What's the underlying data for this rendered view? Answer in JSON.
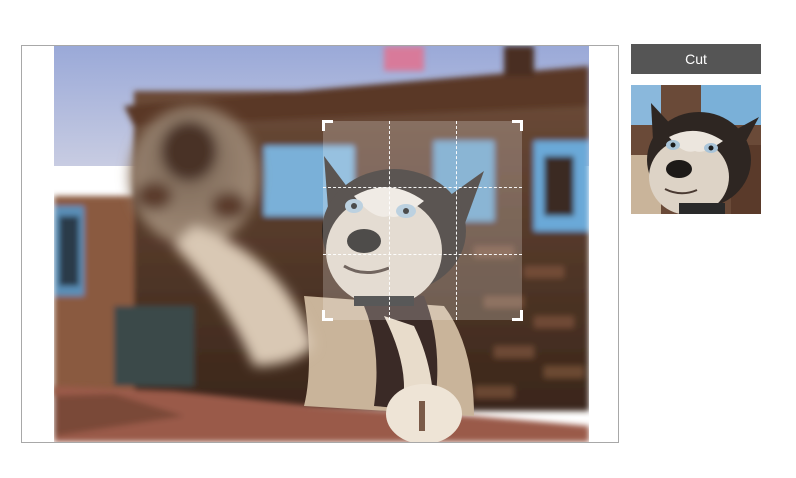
{
  "editor": {
    "photo_description_icon": "husky-photo",
    "crop_grid": "3x3"
  },
  "toolbar": {
    "cut_label": "Cut"
  },
  "colors": {
    "button_bg": "#555555",
    "button_text": "#ffffff",
    "frame_border": "#a8a8a8",
    "crop_guides": "#ffffff"
  }
}
